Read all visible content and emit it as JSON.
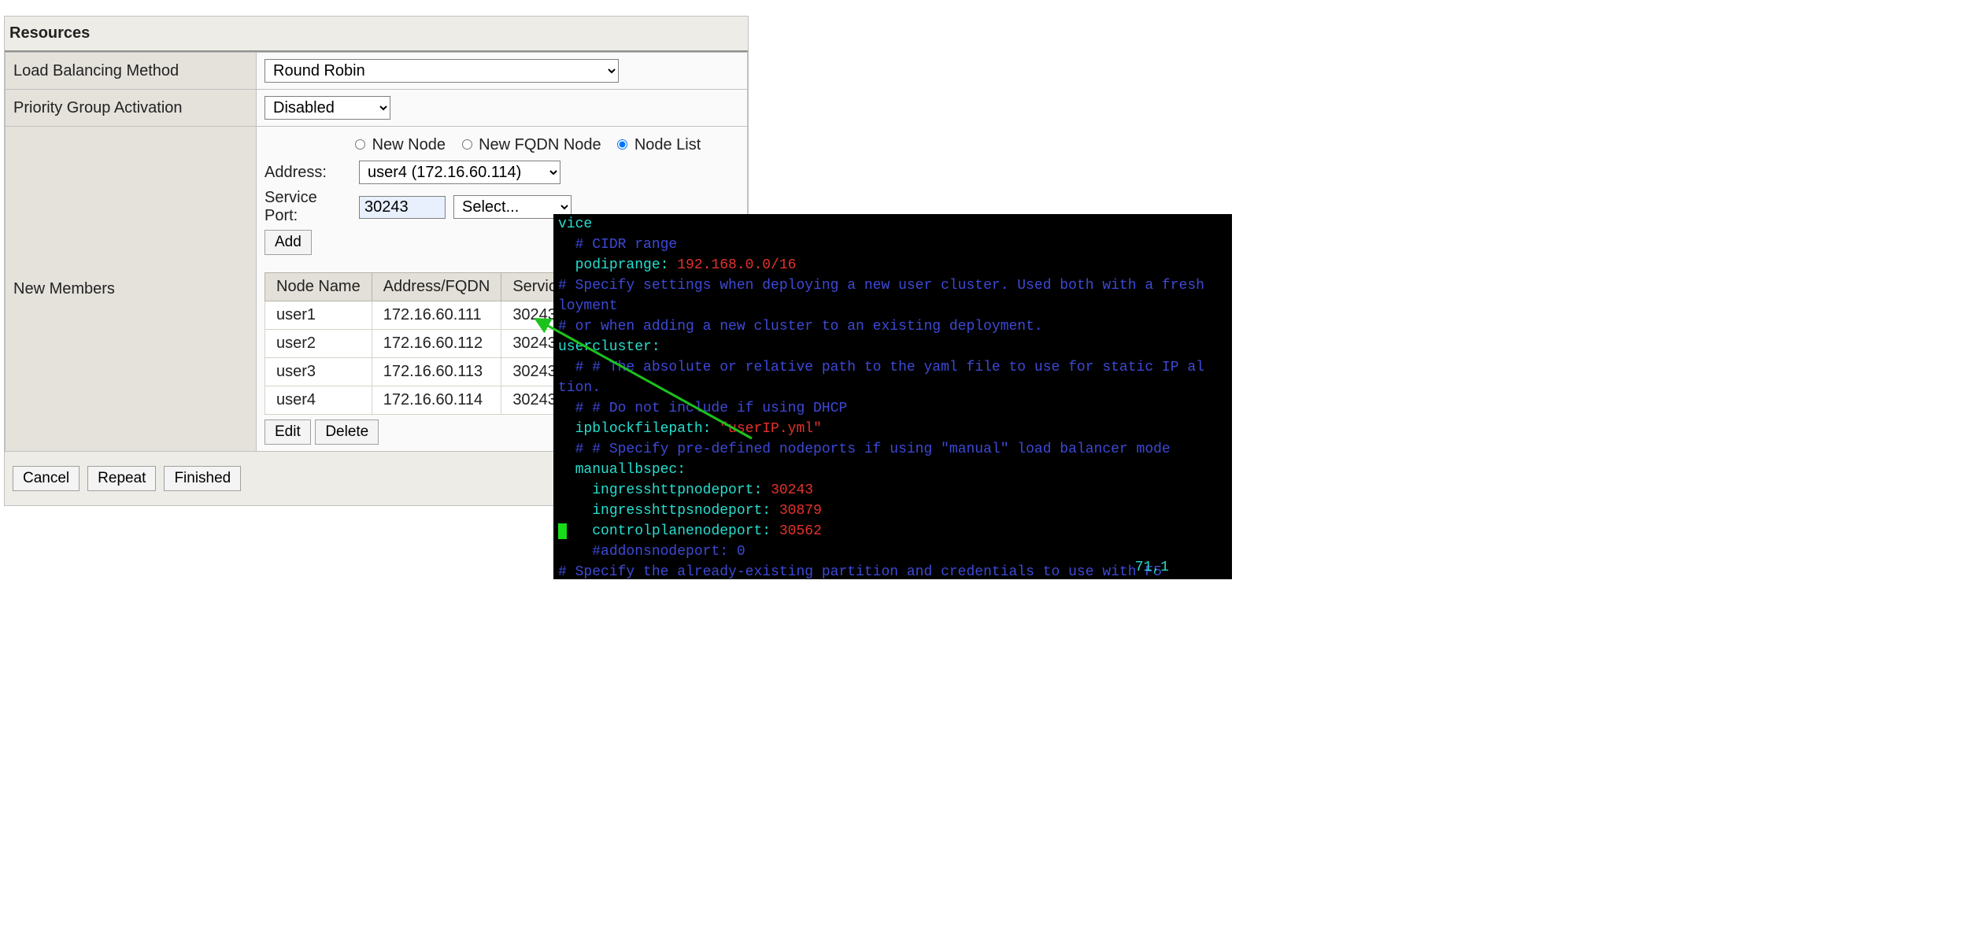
{
  "header": "Resources",
  "rows": {
    "lb_method": {
      "label": "Load Balancing Method",
      "value": "Round Robin"
    },
    "pg_act": {
      "label": "Priority Group Activation",
      "value": "Disabled"
    },
    "new_members_label": "New Members"
  },
  "radios": {
    "new_node": "New Node",
    "new_fqdn": "New FQDN Node",
    "node_list": "Node List"
  },
  "member_form": {
    "address_label": "Address:",
    "address_value": "user4 (172.16.60.114)",
    "port_label": "Service Port:",
    "port_value": "30243",
    "port_select": "Select...",
    "add": "Add"
  },
  "member_table": {
    "cols": [
      "Node Name",
      "Address/FQDN",
      "Service Port"
    ],
    "rows": [
      [
        "user1",
        "172.16.60.111",
        "30243"
      ],
      [
        "user2",
        "172.16.60.112",
        "30243"
      ],
      [
        "user3",
        "172.16.60.113",
        "30243"
      ],
      [
        "user4",
        "172.16.60.114",
        "30243"
      ]
    ],
    "edit": "Edit",
    "delete": "Delete"
  },
  "footer": {
    "cancel": "Cancel",
    "repeat": "Repeat",
    "finished": "Finished"
  },
  "terminal": {
    "podiprange_val": "192.168.0.0/16",
    "ipblock_val": "\"userIP.yml\"",
    "http_port": "30243",
    "https_port": "30879",
    "cp_port": "30562",
    "status": "71,1"
  }
}
